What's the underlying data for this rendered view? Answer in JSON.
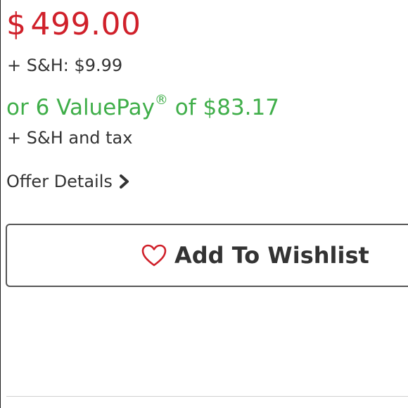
{
  "product": {
    "price_currency": "$",
    "price_amount": "499.00",
    "shipping": "+ S&H: $9.99",
    "valuepay_prefix": "or 6 ValuePay",
    "valuepay_mark": "®",
    "valuepay_suffix": " of $83.17",
    "tax_note": "+ S&H and tax",
    "offer_details": "Offer Details"
  },
  "wishlist": {
    "label": "Add To Wishlist"
  },
  "icons": {
    "offer_chevron": "chevron-right-icon",
    "wishlist_heart": "heart-outline-icon"
  },
  "colors": {
    "price": "#d0202a",
    "valuepay": "#3fae49",
    "text": "#333333",
    "heart": "#d0202a"
  }
}
